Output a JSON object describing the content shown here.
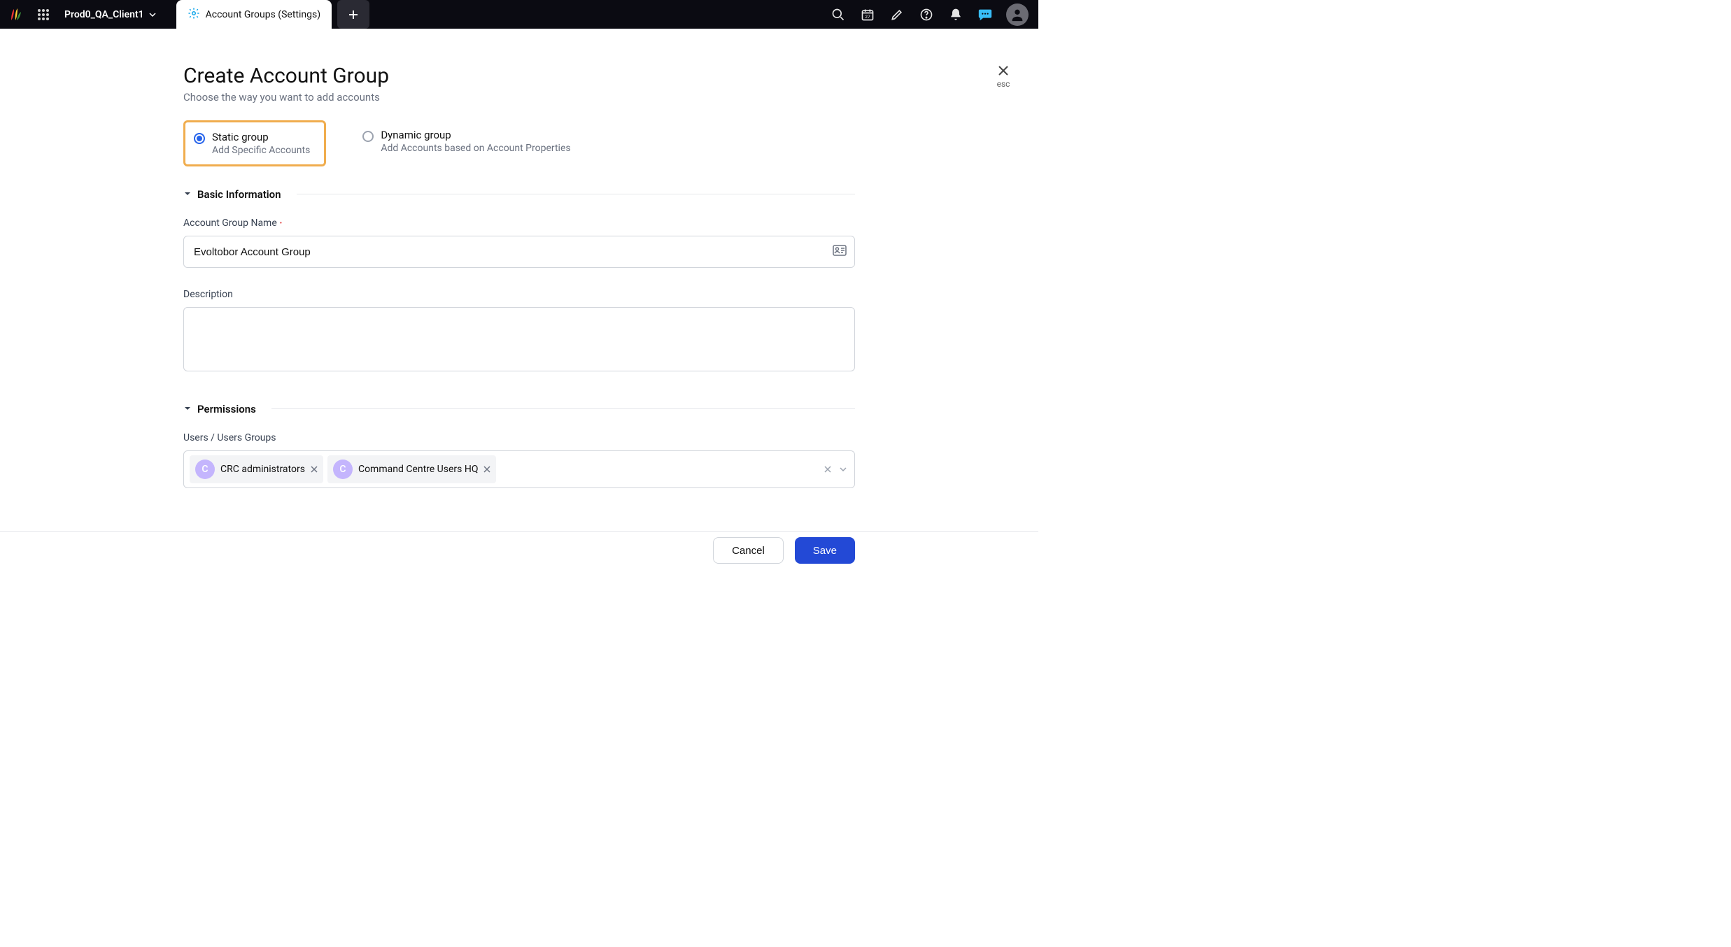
{
  "topbar": {
    "client_name": "Prod0_QA_Client1",
    "tab_label": "Account Groups (Settings)",
    "calendar_day": "27"
  },
  "close": {
    "esc_label": "esc"
  },
  "page": {
    "title": "Create Account Group",
    "subtitle": "Choose the way you want to add accounts"
  },
  "radios": {
    "static": {
      "title": "Static group",
      "subtitle": "Add Specific Accounts"
    },
    "dynamic": {
      "title": "Dynamic group",
      "subtitle": "Add Accounts based on Account Properties"
    }
  },
  "sections": {
    "basic": {
      "title": "Basic Information"
    },
    "permissions": {
      "title": "Permissions"
    }
  },
  "fields": {
    "name": {
      "label": "Account Group Name",
      "value": "Evoltobor Account Group"
    },
    "description": {
      "label": "Description",
      "value": ""
    },
    "users": {
      "label": "Users / Users Groups"
    }
  },
  "chips": [
    {
      "initial": "C",
      "label": "CRC administrators"
    },
    {
      "initial": "C",
      "label": "Command Centre Users HQ"
    }
  ],
  "footer": {
    "cancel": "Cancel",
    "save": "Save"
  }
}
